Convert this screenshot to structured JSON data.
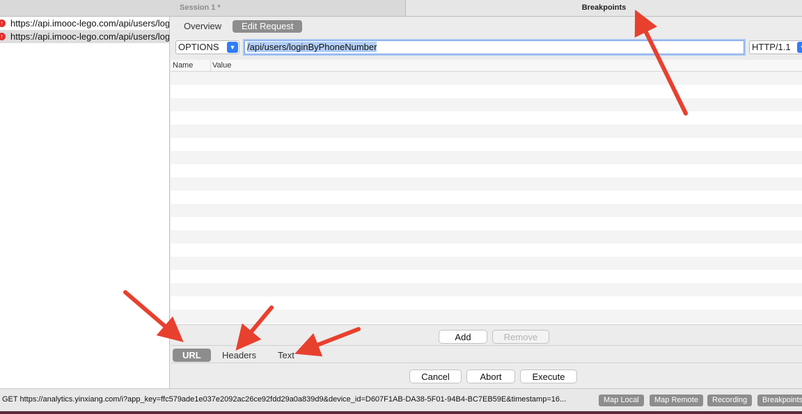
{
  "tabs": {
    "session": "Session 1 *",
    "breakpoints": "Breakpoints"
  },
  "requests": [
    {
      "url": "https://api.imooc-lego.com/api/users/loginByPhoneNumber",
      "icon": "upload-arrow-icon"
    },
    {
      "url": "https://api.imooc-lego.com/api/users/loginByPhoneNumber",
      "icon": "upload-arrow-icon"
    }
  ],
  "subtabs": {
    "overview": "Overview",
    "edit_request": "Edit Request"
  },
  "request_line": {
    "method": "OPTIONS",
    "path": "/api/users/loginByPhoneNumber",
    "protocol": "HTTP/1.1"
  },
  "table": {
    "col_name": "Name",
    "col_value": "Value"
  },
  "row_buttons": {
    "add": "Add",
    "remove": "Remove"
  },
  "bottom_tabs": {
    "url": "URL",
    "headers": "Headers",
    "text": "Text"
  },
  "actions": {
    "cancel": "Cancel",
    "abort": "Abort",
    "execute": "Execute"
  },
  "status": {
    "text": "GET https://analytics.yinxiang.com/i?app_key=ffc579ade1e037e2092ac26ce92fdd29a0a839d9&device_id=D607F1AB-DA38-5F01-94B4-BC7EB59E&timestamp=16...",
    "map_local": "Map Local",
    "map_remote": "Map Remote",
    "recording": "Recording",
    "breakpoints": "Breakpoints"
  },
  "colors": {
    "accent": "#2f7df6",
    "annotation_arrow": "#e8402e",
    "selected_tab": "#8d8d8d"
  }
}
